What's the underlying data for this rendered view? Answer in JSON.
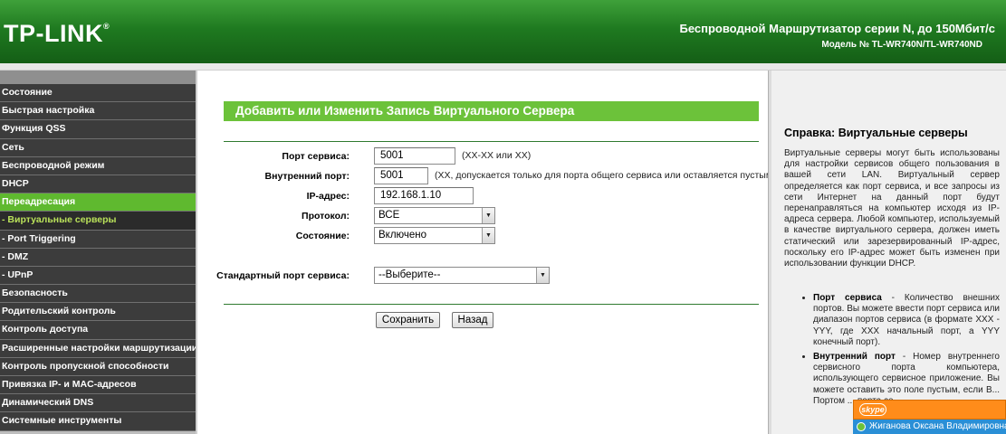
{
  "header": {
    "logo": "TP-LINK",
    "title": "Беспроводной Маршрутизатор серии N, до 150Мбит/с",
    "model": "Модель № TL-WR740N/TL-WR740ND"
  },
  "sidebar": {
    "items": [
      {
        "label": "Состояние"
      },
      {
        "label": "Быстрая настройка"
      },
      {
        "label": "Функция QSS"
      },
      {
        "label": "Сеть"
      },
      {
        "label": "Беспроводной режим"
      },
      {
        "label": "DHCP"
      },
      {
        "label": "Переадресация"
      },
      {
        "label": "- Виртуальные серверы"
      },
      {
        "label": "- Port Triggering"
      },
      {
        "label": "- DMZ"
      },
      {
        "label": "- UPnP"
      },
      {
        "label": "Безопасность"
      },
      {
        "label": "Родительский контроль"
      },
      {
        "label": "Контроль доступа"
      },
      {
        "label": "Расширенные настройки маршрутизации"
      },
      {
        "label": "Контроль пропускной способности"
      },
      {
        "label": "Привязка IP- и MAC-адресов"
      },
      {
        "label": "Динамический DNS"
      },
      {
        "label": "Системные инструменты"
      }
    ]
  },
  "form": {
    "title": "Добавить или Изменить Запись Виртуального Сервера",
    "service_port_label": "Порт сервиса:",
    "service_port_value": "5001",
    "service_port_hint": "(XX-XX или XX)",
    "internal_port_label": "Внутренний порт:",
    "internal_port_value": "5001",
    "internal_port_hint": "(XX, допускается только для порта общего сервиса или оставляется пустым)",
    "ip_label": "IP-адрес:",
    "ip_value": "192.168.1.10",
    "protocol_label": "Протокол:",
    "protocol_value": "ВСЕ",
    "status_label": "Состояние:",
    "status_value": "Включено",
    "std_port_label": "Стандартный порт сервиса:",
    "std_port_value": "--Выберите--",
    "save_label": "Сохранить",
    "back_label": "Назад"
  },
  "help": {
    "title": "Справка: Виртуальные серверы",
    "intro": "Виртуальные серверы могут быть использованы для настройки сервисов общего пользования в вашей сети LAN. Виртуальный сервер определяется как порт сервиса, и все запросы из сети Интернет на данный порт будут перенаправляться на компьютер исходя из IP-адреса сервера. Любой компьютер, используемый в качестве виртуального сервера, должен иметь статический или зарезервированный IP-адрес, поскольку его IP-адрес может быть изменен при использовании функции DHCP.",
    "items": [
      {
        "term": "Порт сервиса",
        "text": " - Количество внешних портов. Вы можете ввести порт сервиса или диапазон портов сервиса (в формате XXX - YYY, где XXX начальный порт, а YYY конечный порт)."
      },
      {
        "term": "Внутренний порт",
        "text": " - Номер внутреннего сервисного порта компьютера, использующего сервисное приложение. Вы можете оставить это поле пустым, если В... Портом ... порта се..."
      }
    ]
  },
  "skype": {
    "logo": "skype",
    "user": "Жиганова Оксана Владимировна"
  }
}
